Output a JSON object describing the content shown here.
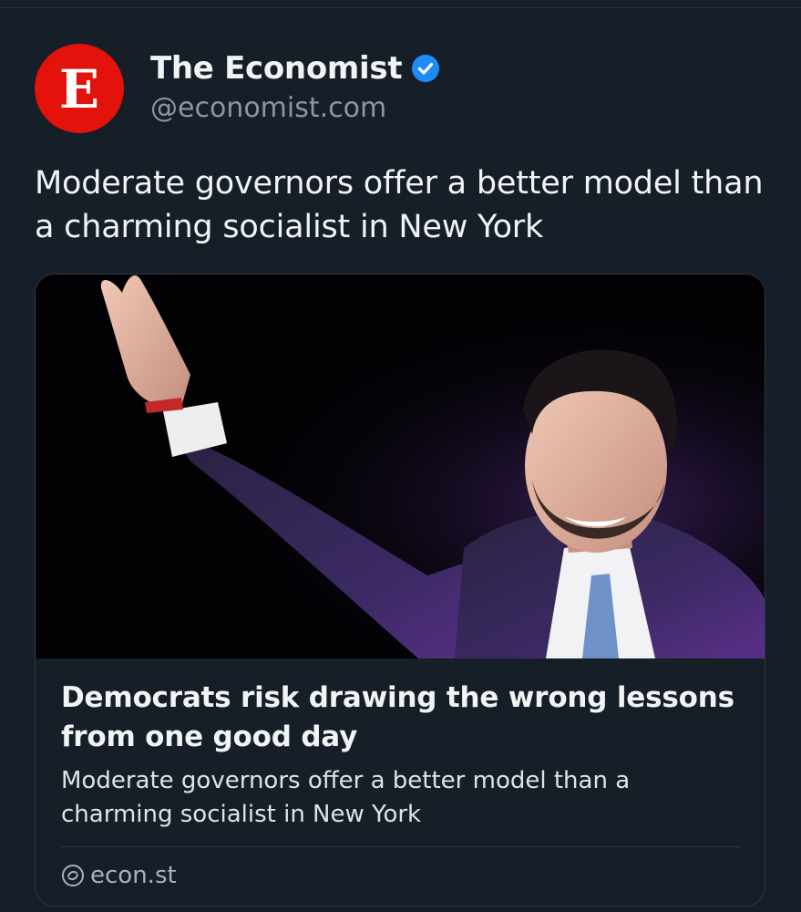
{
  "post": {
    "author": {
      "avatar_letter": "E",
      "name": "The Economist",
      "handle": "@economist.com",
      "verified_icon": "verified-badge-icon",
      "avatar_color": "#e3120b",
      "badge_color": "#1d8cf8"
    },
    "text": "Moderate governors offer a better model than a charming socialist in New York",
    "link_card": {
      "image_description_icon": "photo",
      "headline": "Democrats risk drawing the wrong lessons from one good day",
      "description": "Moderate governors offer a better model than a charming socialist in New York",
      "domain": "econ.st",
      "domain_icon": "link-icon"
    }
  },
  "colors": {
    "background": "#161e27",
    "text_primary": "#f1f3f5",
    "text_secondary": "#8b96a2",
    "border": "#2f3943"
  }
}
